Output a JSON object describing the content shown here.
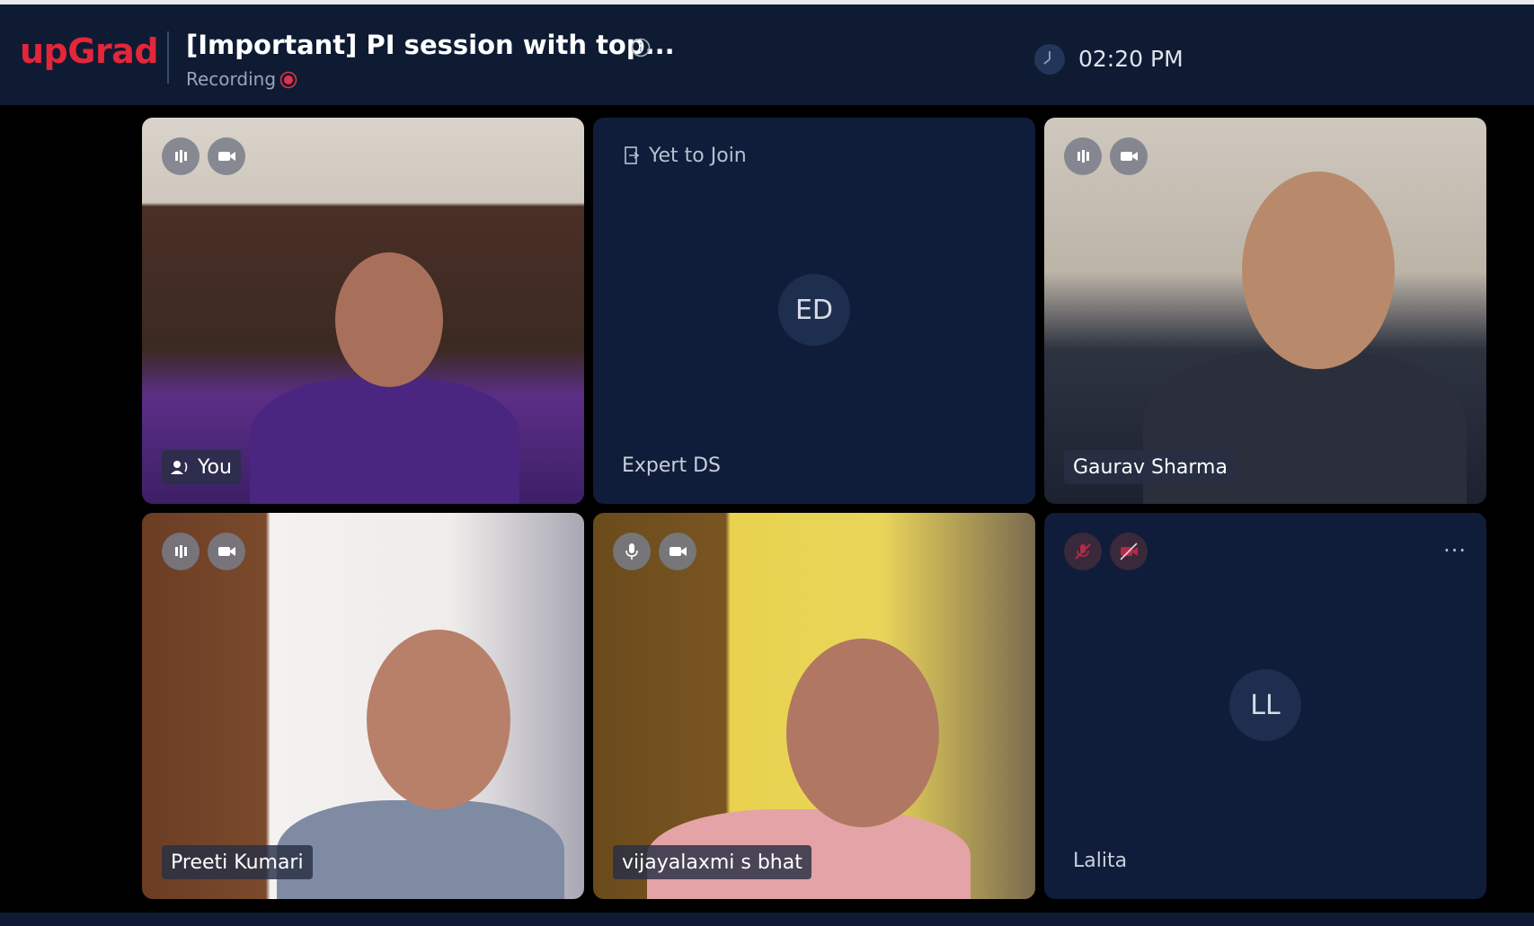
{
  "app": {
    "logo_text": "upGrad",
    "brand_color": "#e3263a"
  },
  "header": {
    "title": "[Important] PI session with top...",
    "recording_label": "Recording",
    "time": "02:20 PM"
  },
  "tiles": [
    {
      "name": "You",
      "mic": "active",
      "camera": "on",
      "speaking_icon": "speaker-icon"
    },
    {
      "name": "Expert DS",
      "status": "Yet to Join",
      "initials": "ED"
    },
    {
      "name": "Gaurav Sharma",
      "mic": "active",
      "camera": "on"
    },
    {
      "name": "Preeti Kumari",
      "mic": "active",
      "camera": "on"
    },
    {
      "name": "vijayalaxmi s bhat",
      "mic": "on",
      "camera": "on"
    },
    {
      "name": "Lalita",
      "initials": "LL",
      "mic": "muted",
      "camera": "off",
      "more_label": "···"
    }
  ]
}
